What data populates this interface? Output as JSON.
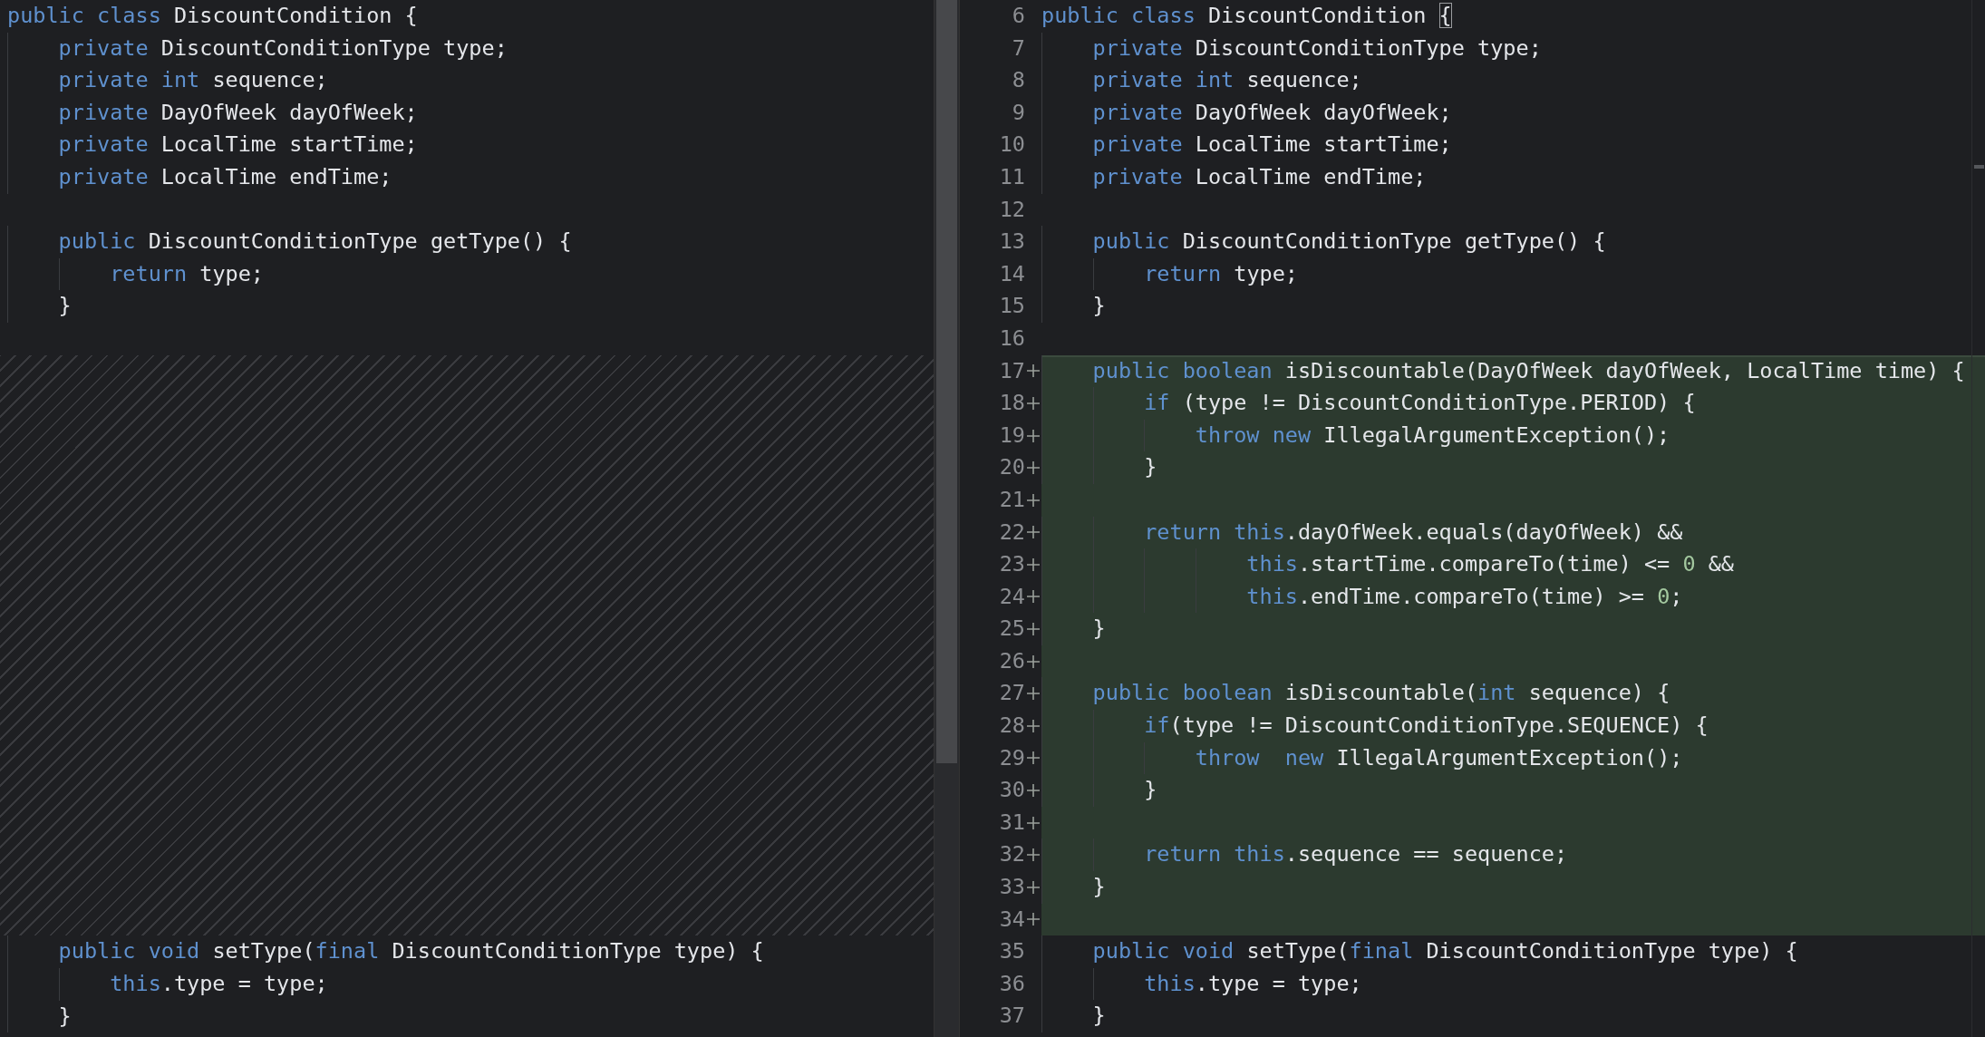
{
  "left_pane": {
    "lines": [
      {
        "kind": "code",
        "tokens": [
          {
            "kind": "kw",
            "text": "public class "
          },
          {
            "kind": "id",
            "text": "DiscountCondition {"
          }
        ]
      },
      {
        "kind": "code",
        "tokens": [
          {
            "kind": "kw",
            "text": "    private "
          },
          {
            "kind": "id",
            "text": "DiscountConditionType type;"
          }
        ]
      },
      {
        "kind": "code",
        "tokens": [
          {
            "kind": "kw",
            "text": "    private int "
          },
          {
            "kind": "id",
            "text": "sequence;"
          }
        ]
      },
      {
        "kind": "code",
        "tokens": [
          {
            "kind": "kw",
            "text": "    private "
          },
          {
            "kind": "id",
            "text": "DayOfWeek dayOfWeek;"
          }
        ]
      },
      {
        "kind": "code",
        "tokens": [
          {
            "kind": "kw",
            "text": "    private "
          },
          {
            "kind": "id",
            "text": "LocalTime startTime;"
          }
        ]
      },
      {
        "kind": "code",
        "tokens": [
          {
            "kind": "kw",
            "text": "    private "
          },
          {
            "kind": "id",
            "text": "LocalTime endTime;"
          }
        ]
      },
      {
        "kind": "blank"
      },
      {
        "kind": "code",
        "tokens": [
          {
            "kind": "kw",
            "text": "    public "
          },
          {
            "kind": "id",
            "text": "DiscountConditionType getType() {"
          }
        ]
      },
      {
        "kind": "code",
        "tokens": [
          {
            "kind": "kw",
            "text": "        return "
          },
          {
            "kind": "id",
            "text": "type;"
          }
        ]
      },
      {
        "kind": "code",
        "tokens": [
          {
            "kind": "id",
            "text": "    }"
          }
        ]
      },
      {
        "kind": "blank"
      },
      {
        "kind": "gap"
      },
      {
        "kind": "gap"
      },
      {
        "kind": "gap"
      },
      {
        "kind": "gap"
      },
      {
        "kind": "gap"
      },
      {
        "kind": "gap"
      },
      {
        "kind": "gap"
      },
      {
        "kind": "gap"
      },
      {
        "kind": "gap"
      },
      {
        "kind": "gap"
      },
      {
        "kind": "gap"
      },
      {
        "kind": "gap"
      },
      {
        "kind": "gap"
      },
      {
        "kind": "gap"
      },
      {
        "kind": "gap"
      },
      {
        "kind": "gap"
      },
      {
        "kind": "gap"
      },
      {
        "kind": "gap"
      },
      {
        "kind": "code",
        "tokens": [
          {
            "kind": "kw",
            "text": "    public void "
          },
          {
            "kind": "id",
            "text": "setType("
          },
          {
            "kind": "kw",
            "text": "final "
          },
          {
            "kind": "id",
            "text": "DiscountConditionType type) {"
          }
        ]
      },
      {
        "kind": "code",
        "tokens": [
          {
            "kind": "kw",
            "text": "        this"
          },
          {
            "kind": "id",
            "text": ".type = type;"
          }
        ]
      },
      {
        "kind": "code",
        "tokens": [
          {
            "kind": "id",
            "text": "    }"
          }
        ]
      }
    ]
  },
  "right_pane": {
    "lines": [
      {
        "number": "6",
        "added": false,
        "tokens": [
          {
            "kind": "kw",
            "text": "public class "
          },
          {
            "kind": "id",
            "text": "DiscountCondition "
          },
          {
            "kind": "match",
            "text": "{"
          }
        ]
      },
      {
        "number": "7",
        "added": false,
        "tokens": [
          {
            "kind": "kw",
            "text": "    private "
          },
          {
            "kind": "id",
            "text": "DiscountConditionType type;"
          }
        ]
      },
      {
        "number": "8",
        "added": false,
        "tokens": [
          {
            "kind": "kw",
            "text": "    private int "
          },
          {
            "kind": "id",
            "text": "sequence;"
          }
        ]
      },
      {
        "number": "9",
        "added": false,
        "tokens": [
          {
            "kind": "kw",
            "text": "    private "
          },
          {
            "kind": "id",
            "text": "DayOfWeek dayOfWeek;"
          }
        ]
      },
      {
        "number": "10",
        "added": false,
        "tokens": [
          {
            "kind": "kw",
            "text": "    private "
          },
          {
            "kind": "id",
            "text": "LocalTime startTime;"
          }
        ]
      },
      {
        "number": "11",
        "added": false,
        "tokens": [
          {
            "kind": "kw",
            "text": "    private "
          },
          {
            "kind": "id",
            "text": "LocalTime endTime;"
          }
        ]
      },
      {
        "number": "12",
        "added": false
      },
      {
        "number": "13",
        "added": false,
        "tokens": [
          {
            "kind": "kw",
            "text": "    public "
          },
          {
            "kind": "id",
            "text": "DiscountConditionType getType() {"
          }
        ]
      },
      {
        "number": "14",
        "added": false,
        "tokens": [
          {
            "kind": "kw",
            "text": "        return "
          },
          {
            "kind": "id",
            "text": "type;"
          }
        ]
      },
      {
        "number": "15",
        "added": false,
        "tokens": [
          {
            "kind": "id",
            "text": "    }"
          }
        ]
      },
      {
        "number": "16",
        "added": false
      },
      {
        "number": "17",
        "added": true,
        "tokens": [
          {
            "kind": "kw",
            "text": "    public boolean "
          },
          {
            "kind": "id",
            "text": "isDiscountable(DayOfWeek dayOfWeek, LocalTime time) {"
          }
        ]
      },
      {
        "number": "18",
        "added": true,
        "tokens": [
          {
            "kind": "kw",
            "text": "        if "
          },
          {
            "kind": "id",
            "text": "(type != DiscountConditionType.PERIOD) {"
          }
        ]
      },
      {
        "number": "19",
        "added": true,
        "tokens": [
          {
            "kind": "kw",
            "text": "            throw new "
          },
          {
            "kind": "id",
            "text": "IllegalArgumentException();"
          }
        ]
      },
      {
        "number": "20",
        "added": true,
        "tokens": [
          {
            "kind": "id",
            "text": "        }"
          }
        ]
      },
      {
        "number": "21",
        "added": true
      },
      {
        "number": "22",
        "added": true,
        "tokens": [
          {
            "kind": "kw",
            "text": "        return this"
          },
          {
            "kind": "id",
            "text": ".dayOfWeek.equals(dayOfWeek) &&"
          }
        ]
      },
      {
        "number": "23",
        "added": true,
        "tokens": [
          {
            "kind": "kw",
            "text": "                this"
          },
          {
            "kind": "id",
            "text": ".startTime.compareTo(time) <= "
          },
          {
            "kind": "num",
            "text": "0"
          },
          {
            "kind": "id",
            "text": " &&"
          }
        ]
      },
      {
        "number": "24",
        "added": true,
        "tokens": [
          {
            "kind": "kw",
            "text": "                this"
          },
          {
            "kind": "id",
            "text": ".endTime.compareTo(time) >= "
          },
          {
            "kind": "num",
            "text": "0"
          },
          {
            "kind": "id",
            "text": ";"
          }
        ]
      },
      {
        "number": "25",
        "added": true,
        "tokens": [
          {
            "kind": "id",
            "text": "    }"
          }
        ]
      },
      {
        "number": "26",
        "added": true
      },
      {
        "number": "27",
        "added": true,
        "tokens": [
          {
            "kind": "kw",
            "text": "    public boolean "
          },
          {
            "kind": "id",
            "text": "isDiscountable("
          },
          {
            "kind": "kw",
            "text": "int "
          },
          {
            "kind": "id",
            "text": "sequence) {"
          }
        ]
      },
      {
        "number": "28",
        "added": true,
        "tokens": [
          {
            "kind": "kw",
            "text": "        if"
          },
          {
            "kind": "id",
            "text": "(type != DiscountConditionType.SEQUENCE) {"
          }
        ]
      },
      {
        "number": "29",
        "added": true,
        "tokens": [
          {
            "kind": "kw",
            "text": "            throw  new "
          },
          {
            "kind": "id",
            "text": "IllegalArgumentException();"
          }
        ]
      },
      {
        "number": "30",
        "added": true,
        "tokens": [
          {
            "kind": "id",
            "text": "        }"
          }
        ]
      },
      {
        "number": "31",
        "added": true
      },
      {
        "number": "32",
        "added": true,
        "tokens": [
          {
            "kind": "kw",
            "text": "        return this"
          },
          {
            "kind": "id",
            "text": ".sequence == sequence;"
          }
        ]
      },
      {
        "number": "33",
        "added": true,
        "tokens": [
          {
            "kind": "id",
            "text": "    }"
          }
        ]
      },
      {
        "number": "34",
        "added": true
      },
      {
        "number": "35",
        "added": false,
        "tokens": [
          {
            "kind": "kw",
            "text": "    public void "
          },
          {
            "kind": "id",
            "text": "setType("
          },
          {
            "kind": "kw",
            "text": "final "
          },
          {
            "kind": "id",
            "text": "DiscountConditionType type) {"
          }
        ]
      },
      {
        "number": "36",
        "added": false,
        "tokens": [
          {
            "kind": "kw",
            "text": "        this"
          },
          {
            "kind": "id",
            "text": ".type = type;"
          }
        ]
      },
      {
        "number": "37",
        "added": false,
        "tokens": [
          {
            "kind": "id",
            "text": "    }"
          }
        ]
      }
    ]
  }
}
